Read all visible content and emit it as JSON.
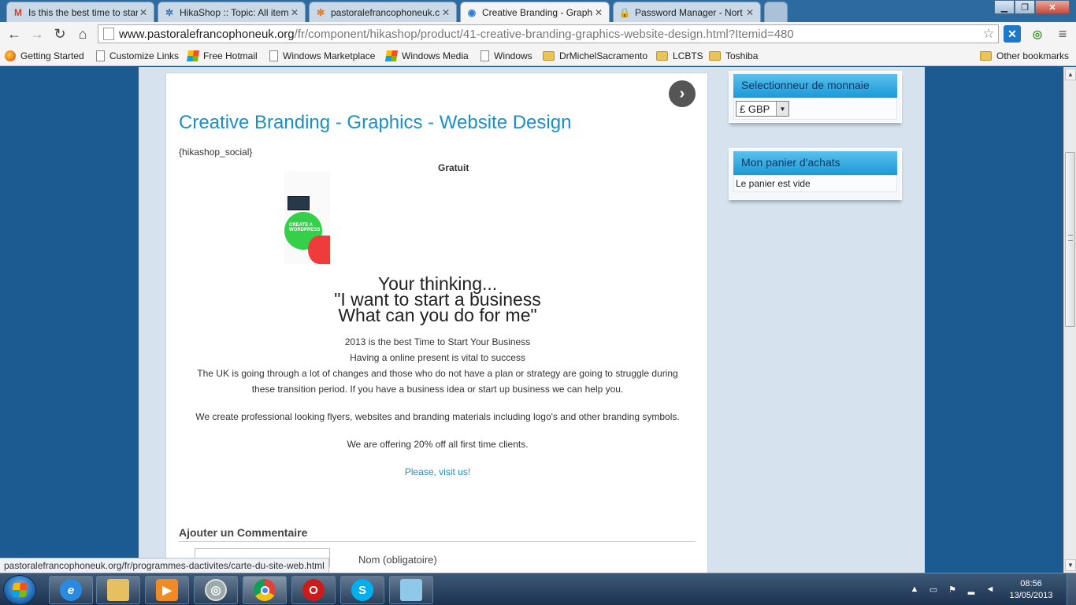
{
  "tabs": [
    {
      "label": "Is this the best time to star",
      "icon": "gmail-icon"
    },
    {
      "label": "HikaShop :: Topic: All item",
      "icon": "hikashop-icon"
    },
    {
      "label": "pastoralefrancophoneuk.c",
      "icon": "joomla-icon"
    },
    {
      "label": "Creative Branding - Graph",
      "icon": "web-icon",
      "active": true
    },
    {
      "label": "Password Manager - Nort",
      "icon": "lock-icon"
    }
  ],
  "toolbar": {
    "url_host": "www.pastoralefrancophoneuk.org",
    "url_path": "/fr/component/hikashop/product/41-creative-branding-graphics-website-design.html?Itemid=480"
  },
  "bookmarks": [
    {
      "label": "Getting Started",
      "icon": "firefox-icon"
    },
    {
      "label": "Customize Links",
      "icon": "page-icon"
    },
    {
      "label": "Free Hotmail",
      "icon": "windows-icon"
    },
    {
      "label": "Windows Marketplace",
      "icon": "page-icon"
    },
    {
      "label": "Windows Media",
      "icon": "windows-icon"
    },
    {
      "label": "Windows",
      "icon": "page-icon"
    },
    {
      "label": "DrMichelSacramento",
      "icon": "folder-icon"
    },
    {
      "label": "LCBTS",
      "icon": "folder-icon"
    },
    {
      "label": "Toshiba",
      "icon": "folder-icon"
    }
  ],
  "other_bookmarks": "Other bookmarks",
  "product": {
    "title": "Creative Branding - Graphics - Website Design",
    "social_tag": "{hikashop_social}",
    "price": "Gratuit",
    "headline": [
      "Your thinking...",
      "\"I want to start a business",
      "What can you do for me\""
    ],
    "body_lines": [
      "2013 is the best Time to Start Your Business",
      "Having a online present is vital to success",
      "The UK is going through a lot of changes and those who do not have a plan or strategy are going to struggle during",
      "these transition period. If you have a business idea or start up business we can help you."
    ],
    "paragraph_2": "We create professional looking flyers, websites and branding materials including logo's and other branding symbols.",
    "paragraph_3": "We are offering 20% off all first time clients.",
    "link": "Please, visit us!",
    "image_text": "CREATE A WORDPRESS"
  },
  "comments": {
    "heading": "Ajouter un Commentaire",
    "name_label": "Nom (obligatoire)"
  },
  "sidebar": {
    "currency_title": "Selectionneur de monnaie",
    "currency_value": "£ GBP",
    "cart_title": "Mon panier d'achats",
    "cart_status": "Le panier est vide"
  },
  "status_bar": "pastoralefrancophoneuk.org/fr/programmes-dactivites/carte-du-site-web.html",
  "clock": {
    "time": "08:56",
    "date": "13/05/2013"
  }
}
